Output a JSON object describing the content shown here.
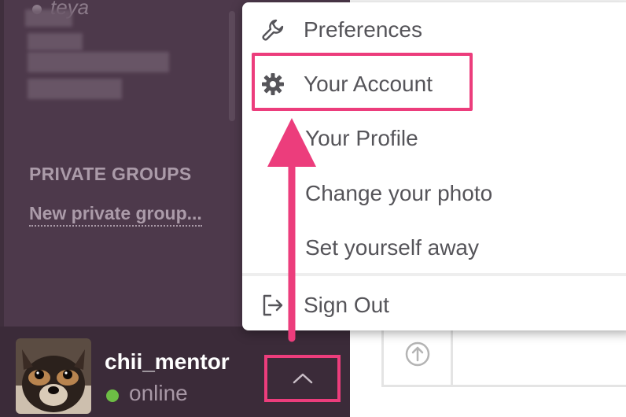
{
  "sidebar": {
    "partial_channel": "teya",
    "private_groups_title": "PRIVATE GROUPS",
    "new_private_group_link": "New private group..."
  },
  "footer": {
    "username": "chii_mentor",
    "status": "online",
    "status_color": "#6dbd45"
  },
  "menu": {
    "items": [
      {
        "label": "Preferences",
        "icon": "wrench-icon"
      },
      {
        "label": "Your Account",
        "icon": "gear-icon"
      },
      {
        "label": "Your Profile",
        "icon": ""
      },
      {
        "label": "Change your photo",
        "icon": ""
      },
      {
        "label": "Set yourself away",
        "icon": ""
      },
      {
        "label": "Sign Out",
        "icon": "sign-out-icon"
      }
    ]
  },
  "colors": {
    "sidebar_bg": "#4d394b",
    "highlight": "#ec3d7c",
    "menu_text": "#555459"
  }
}
